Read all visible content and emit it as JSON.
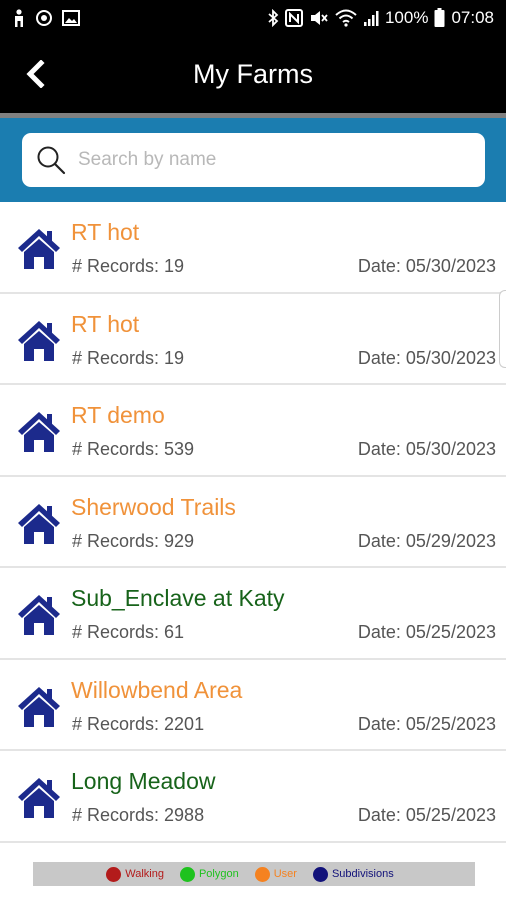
{
  "status_bar": {
    "battery": "100%",
    "time": "07:08"
  },
  "header": {
    "title": "My Farms"
  },
  "search": {
    "placeholder": "Search by name",
    "value": ""
  },
  "farms": [
    {
      "name": "RT hot",
      "records": "# Records: 19",
      "date": "Date: 05/30/2023",
      "color": "#f0923a"
    },
    {
      "name": "RT hot",
      "records": "# Records: 19",
      "date": "Date: 05/30/2023",
      "color": "#f0923a"
    },
    {
      "name": "RT demo",
      "records": "# Records: 539",
      "date": "Date: 05/30/2023",
      "color": "#f0923a"
    },
    {
      "name": "Sherwood Trails",
      "records": "# Records: 929",
      "date": "Date: 05/29/2023",
      "color": "#f0923a"
    },
    {
      "name": "Sub_Enclave at Katy",
      "records": "# Records: 61",
      "date": "Date: 05/25/2023",
      "color": "#17631a"
    },
    {
      "name": "Willowbend Area",
      "records": "# Records: 2201",
      "date": "Date: 05/25/2023",
      "color": "#f0923a"
    },
    {
      "name": "Long Meadow",
      "records": "# Records: 2988",
      "date": "Date: 05/25/2023",
      "color": "#17631a"
    }
  ],
  "legend": [
    {
      "label": "Walking",
      "dot_color": "#b31b1b",
      "text_color": "#b31b1b"
    },
    {
      "label": "Polygon",
      "dot_color": "#1ec21e",
      "text_color": "#1ec21e"
    },
    {
      "label": "User",
      "dot_color": "#f58220",
      "text_color": "#f58220"
    },
    {
      "label": "Subdivisions",
      "dot_color": "#12127a",
      "text_color": "#12127a"
    }
  ],
  "icons": {
    "farm": "house-icon",
    "back": "chevron-left-icon",
    "search": "search-icon"
  },
  "colors": {
    "header_bg": "#000000",
    "search_band": "#1b7db0",
    "house_icon": "#1c2a8c"
  }
}
